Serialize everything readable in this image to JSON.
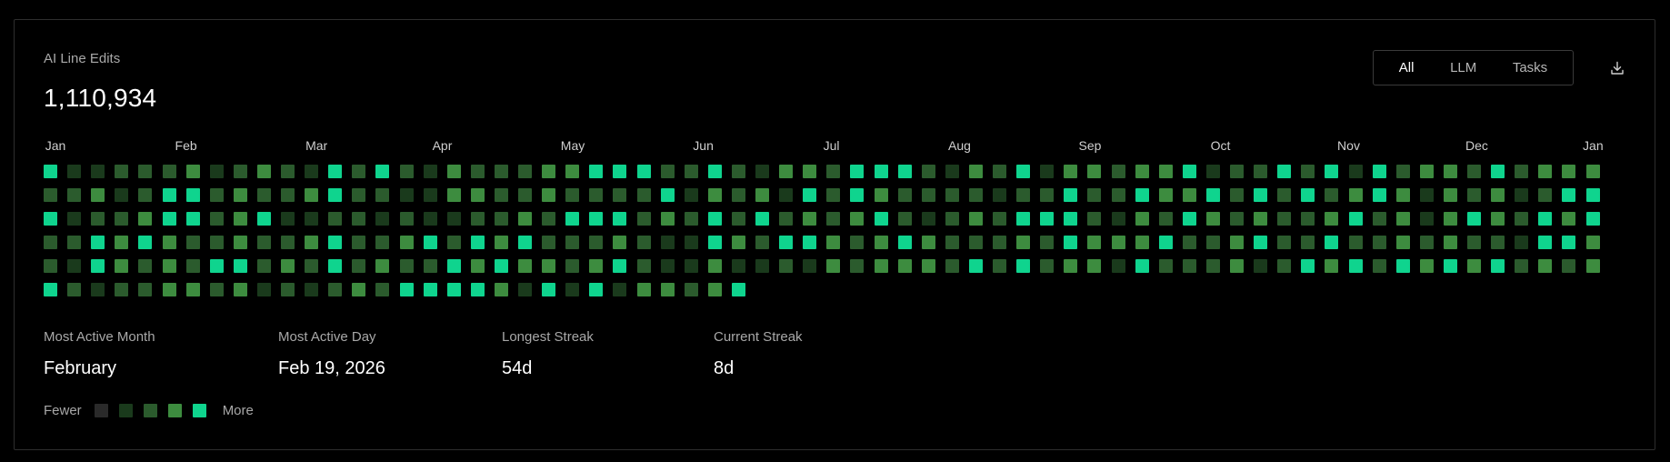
{
  "header": {
    "title": "AI Line Edits",
    "total": "1,110,934"
  },
  "filters": [
    {
      "label": "All",
      "active": true
    },
    {
      "label": "LLM",
      "active": false
    },
    {
      "label": "Tasks",
      "active": false
    }
  ],
  "download": {
    "icon": "download-icon"
  },
  "months": [
    "Jan",
    "Feb",
    "Mar",
    "Apr",
    "May",
    "Jun",
    "Jul",
    "Aug",
    "Sep",
    "Oct",
    "Nov",
    "Dec",
    "Jan"
  ],
  "colors": {
    "level0": "#2a2a2a",
    "level1": "#1a3a1c",
    "level2": "#2b5b2d",
    "level3": "#3d8c3f",
    "level4": "#0fd48e"
  },
  "heatmap": {
    "rows": [
      [
        4,
        1,
        1,
        2,
        2,
        2,
        3,
        1,
        2,
        3,
        2,
        1,
        4,
        2,
        4,
        2,
        1,
        3,
        2,
        2,
        2,
        3,
        3,
        4,
        4,
        4,
        2,
        2,
        4,
        2,
        1,
        3,
        3,
        2,
        4,
        4,
        4,
        2,
        1,
        3,
        2,
        4,
        1,
        3,
        3,
        2,
        3,
        3,
        4,
        1,
        2,
        2,
        4,
        2,
        4,
        1,
        4,
        2,
        3,
        3,
        2,
        4,
        2,
        3,
        3,
        3
      ],
      [
        2,
        2,
        3,
        1,
        2,
        4,
        4,
        2,
        3,
        2,
        2,
        3,
        4,
        2,
        2,
        1,
        1,
        3,
        3,
        2,
        2,
        3,
        2,
        2,
        2,
        2,
        4,
        1,
        3,
        2,
        3,
        1,
        4,
        2,
        4,
        3,
        2,
        2,
        2,
        2,
        1,
        2,
        2,
        4,
        2,
        2,
        4,
        3,
        3,
        4,
        2,
        4,
        2,
        4,
        2,
        3,
        4,
        3,
        1,
        3,
        2,
        3,
        1,
        2,
        4,
        4
      ],
      [
        4,
        1,
        2,
        2,
        3,
        4,
        4,
        2,
        3,
        4,
        1,
        1,
        2,
        2,
        1,
        2,
        1,
        1,
        2,
        2,
        3,
        2,
        4,
        4,
        4,
        2,
        3,
        2,
        4,
        2,
        4,
        2,
        3,
        2,
        3,
        4,
        2,
        1,
        2,
        3,
        2,
        4,
        4,
        4,
        2,
        1,
        3,
        2,
        4,
        3,
        2,
        3,
        2,
        2,
        3,
        4,
        2,
        3,
        1,
        3,
        4,
        3,
        2,
        4,
        3,
        4
      ],
      [
        2,
        2,
        4,
        3,
        4,
        3,
        2,
        2,
        3,
        2,
        2,
        3,
        4,
        2,
        2,
        3,
        4,
        2,
        4,
        3,
        4,
        2,
        2,
        2,
        3,
        2,
        1,
        1,
        4,
        3,
        2,
        4,
        4,
        3,
        2,
        3,
        4,
        3,
        2,
        2,
        2,
        3,
        2,
        4,
        3,
        3,
        3,
        4,
        2,
        2,
        3,
        4,
        2,
        2,
        4,
        2,
        2,
        3,
        2,
        3,
        2,
        2,
        1,
        4,
        4,
        3
      ],
      [
        2,
        1,
        4,
        3,
        2,
        3,
        2,
        4,
        4,
        2,
        3,
        2,
        4,
        2,
        3,
        2,
        2,
        4,
        3,
        4,
        3,
        3,
        2,
        3,
        4,
        2,
        1,
        1,
        3,
        1,
        1,
        2,
        1,
        3,
        2,
        3,
        3,
        3,
        2,
        4,
        2,
        4,
        2,
        3,
        3,
        1,
        4,
        2,
        2,
        2,
        3,
        1,
        2,
        4,
        3,
        4,
        2,
        4,
        3,
        4,
        3,
        4,
        2,
        3,
        2,
        3
      ],
      [
        4,
        2,
        1,
        2,
        2,
        3,
        3,
        2,
        3,
        1,
        2,
        1,
        2,
        3,
        2,
        4,
        4,
        4,
        4,
        3,
        1,
        4,
        1,
        4,
        1,
        3,
        3,
        2,
        3,
        4
      ]
    ]
  },
  "stats": [
    {
      "label": "Most Active Month",
      "value": "February"
    },
    {
      "label": "Most Active Day",
      "value": "Feb 19, 2026"
    },
    {
      "label": "Longest Streak",
      "value": "54d"
    },
    {
      "label": "Current Streak",
      "value": "8d"
    }
  ],
  "legend": {
    "fewer": "Fewer",
    "more": "More"
  }
}
